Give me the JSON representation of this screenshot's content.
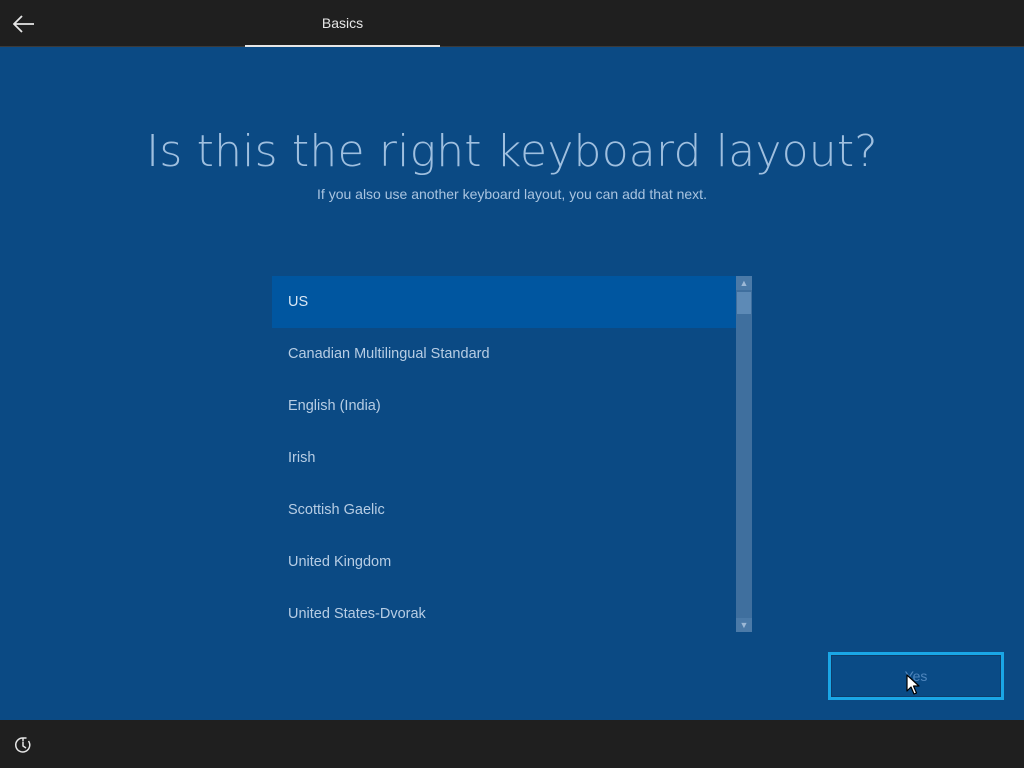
{
  "header": {
    "back_icon": "back-arrow-icon",
    "tab_label": "Basics"
  },
  "main": {
    "title": "Is this the right keyboard layout?",
    "subtitle": "If you also use another keyboard layout, you can add that next.",
    "layouts": [
      {
        "label": "US",
        "selected": true
      },
      {
        "label": "Canadian Multilingual Standard",
        "selected": false
      },
      {
        "label": "English (India)",
        "selected": false
      },
      {
        "label": "Irish",
        "selected": false
      },
      {
        "label": "Scottish Gaelic",
        "selected": false
      },
      {
        "label": "United Kingdom",
        "selected": false
      },
      {
        "label": "United States-Dvorak",
        "selected": false
      }
    ]
  },
  "actions": {
    "yes_label": "Yes"
  },
  "footer": {
    "accessibility_icon": "ease-of-access-icon"
  },
  "colors": {
    "background": "#0b4a84",
    "selected_item": "#0056a0",
    "focus_border": "#1aa6e6",
    "bar": "#1f1f1f"
  }
}
